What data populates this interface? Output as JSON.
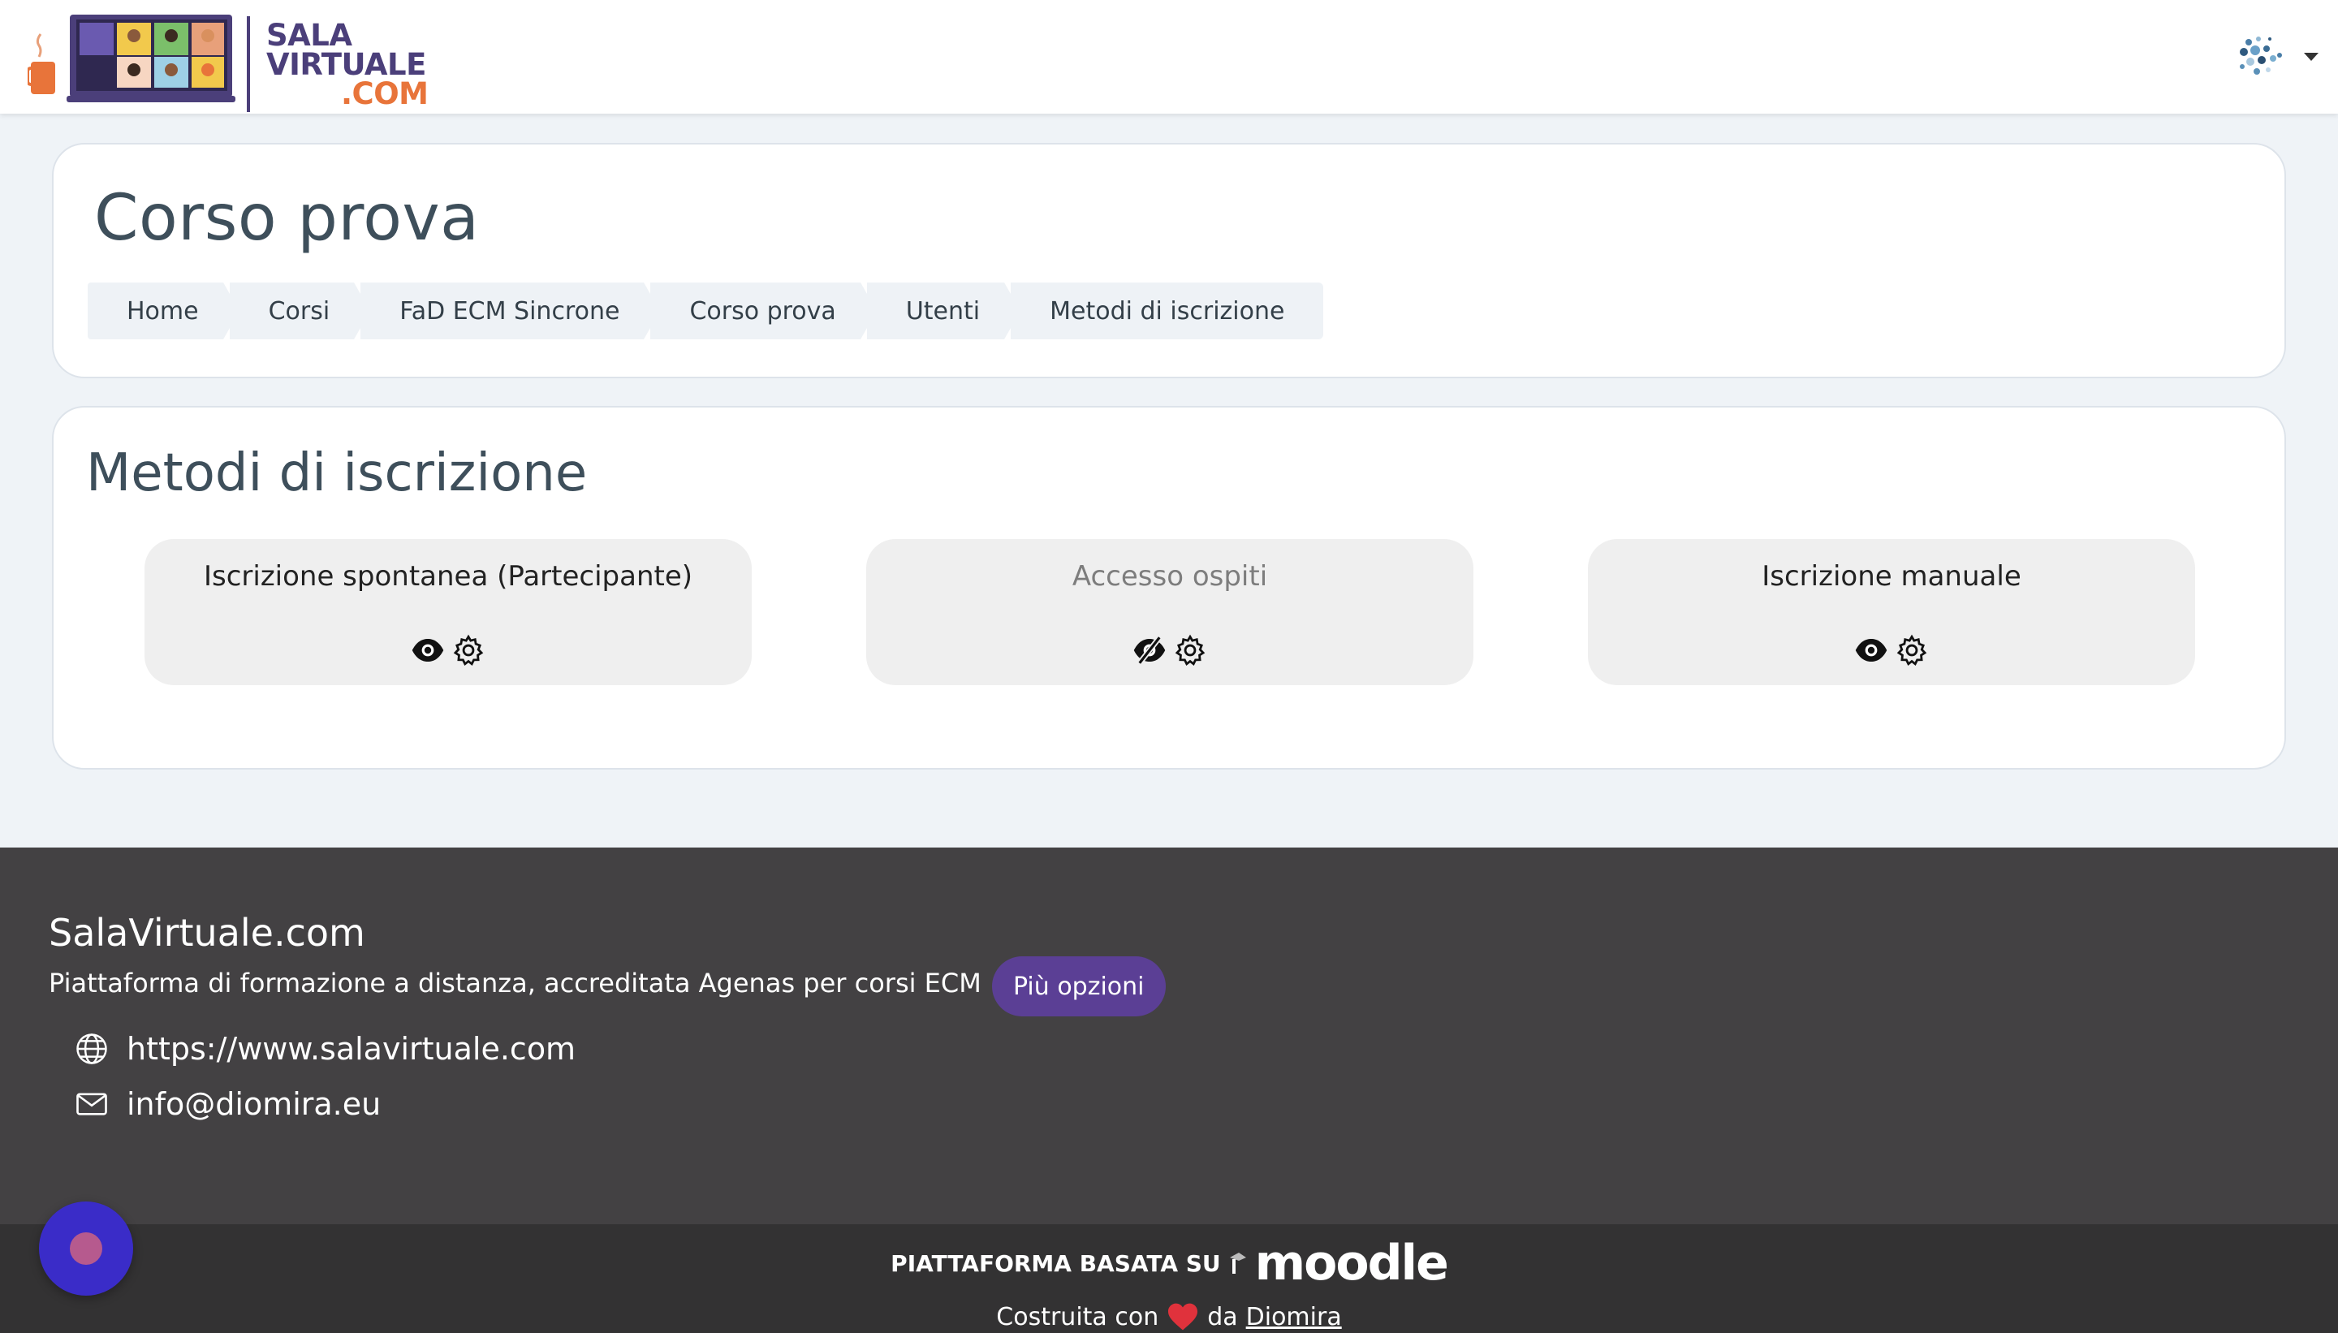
{
  "header": {
    "logo": {
      "line1": "SALA",
      "line2": "VIRTUALE",
      "line3": ".COM"
    },
    "user_menu_icon": "user-avatar-icon"
  },
  "page": {
    "title": "Corso prova",
    "breadcrumb": [
      "Home",
      "Corsi",
      "FaD ECM Sincrone",
      "Corso prova",
      "Utenti",
      "Metodi di iscrizione"
    ]
  },
  "section": {
    "title": "Metodi di iscrizione",
    "methods": [
      {
        "name": "Iscrizione spontanea (Partecipante)",
        "enabled": true,
        "icons": [
          "eye-icon",
          "gear-icon"
        ]
      },
      {
        "name": "Accesso ospiti",
        "enabled": false,
        "icons": [
          "eye-slash-icon",
          "gear-icon"
        ]
      },
      {
        "name": "Iscrizione manuale",
        "enabled": true,
        "icons": [
          "eye-icon",
          "gear-icon"
        ]
      }
    ]
  },
  "footer": {
    "site_name": "SalaVirtuale.com",
    "description": "Piattaforma di formazione a distanza, accreditata Agenas per corsi ECM",
    "more_button": "Più opzioni",
    "website": "https://www.salavirtuale.com",
    "email": "info@diomira.eu",
    "powered_by": "PIATTAFORMA BASATA SU",
    "moodle": "moodle",
    "built_with": "Costruita con",
    "by": "da",
    "author": "Diomira"
  },
  "colors": {
    "brand_purple": "#4b3f7a",
    "brand_orange": "#e8743a",
    "button_purple": "#5b3f95",
    "footer_bg": "#434143",
    "subfooter_bg": "#333233",
    "heart": "#e0323c",
    "chat_bubble": "#3a2cc8"
  }
}
